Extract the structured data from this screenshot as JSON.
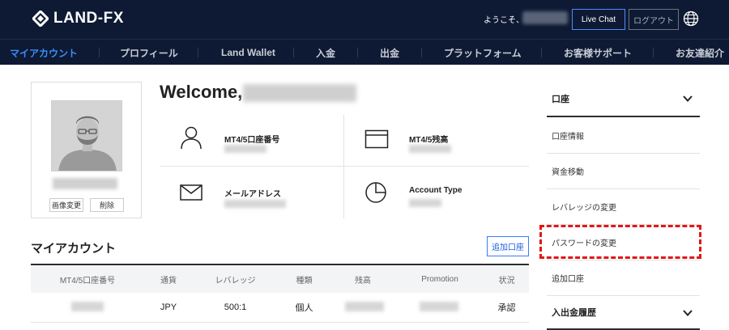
{
  "header": {
    "logo_text": "LAND-FX",
    "welcome_prefix": "ようこそ、",
    "live_chat_label": "Live Chat",
    "logout_label": "ログアウト",
    "bg_color": "#0e1a33",
    "accent_color": "#3a8dff"
  },
  "nav": {
    "items": [
      {
        "label": "マイアカウント",
        "active": true
      },
      {
        "label": "プロフィール"
      },
      {
        "label": "Land Wallet"
      },
      {
        "label": "入金"
      },
      {
        "label": "出金"
      },
      {
        "label": "プラットフォーム"
      },
      {
        "label": "お客様サポート"
      },
      {
        "label": "お友達紹介"
      }
    ]
  },
  "profile": {
    "change_image_label": "画像変更",
    "delete_label": "削除"
  },
  "welcome": {
    "title": "Welcome,"
  },
  "info": {
    "account_number_label": "MT4/5口座番号",
    "balance_label": "MT4/5残高",
    "email_label": "メールアドレス",
    "account_type_label": "Account Type"
  },
  "accounts": {
    "title": "マイアカウント",
    "add_button_label": "追加口座",
    "columns": [
      "MT4/5口座番号",
      "通貨",
      "レバレッジ",
      "種類",
      "残高",
      "Promotion",
      "状況"
    ],
    "rows": [
      {
        "currency": "JPY",
        "leverage": "500:1",
        "type": "個人",
        "status": "承認"
      }
    ]
  },
  "sidebar": {
    "section_account": "口座",
    "items": [
      {
        "label": "口座情報"
      },
      {
        "label": "資金移動"
      },
      {
        "label": "レバレッジの変更"
      },
      {
        "label": "パスワードの変更",
        "highlighted": true
      },
      {
        "label": "追加口座"
      }
    ],
    "section_history": "入出金履歴",
    "highlight_color": "#e01818"
  }
}
